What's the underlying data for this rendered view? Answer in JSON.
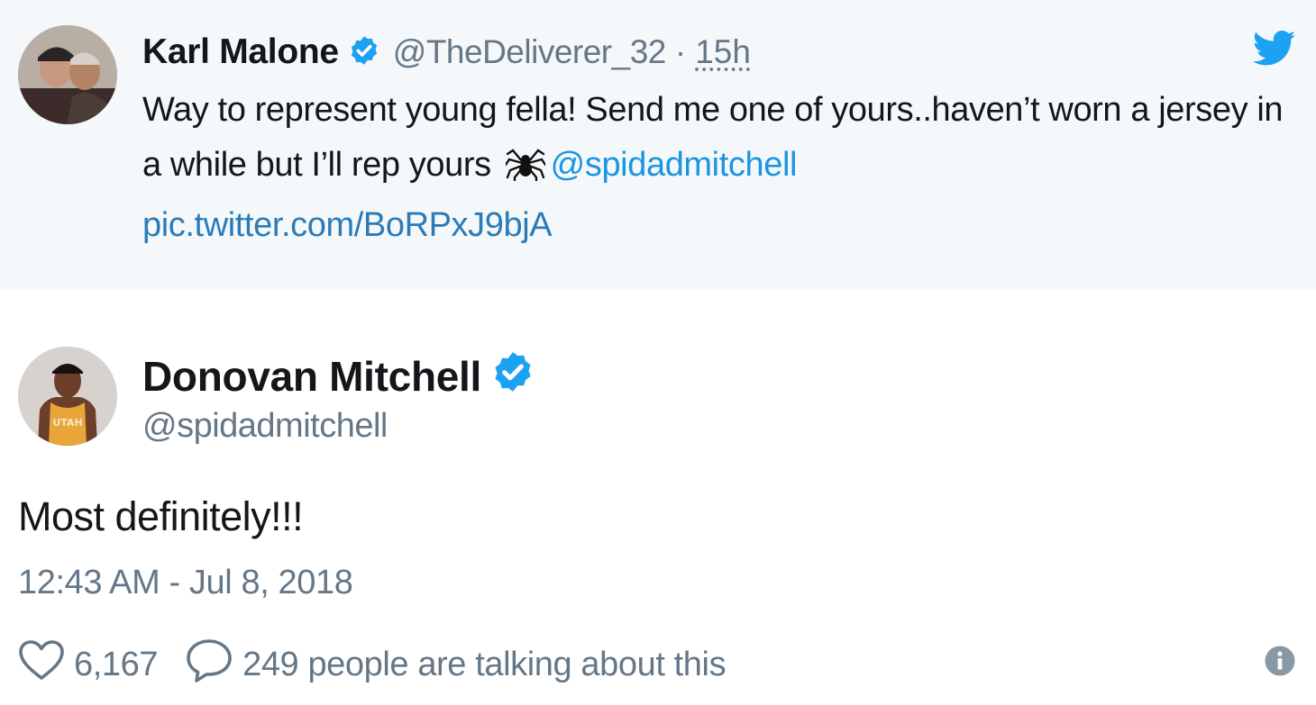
{
  "quoted_tweet": {
    "author_name": "Karl Malone",
    "handle": "@TheDeliverer_32",
    "separator": "·",
    "time": "15h",
    "text_part1": "Way to represent young fella! Send me one of yours..haven’t worn a jersey in a while but I’ll rep yours",
    "mention": "@spidadmitchell",
    "pic_link": "pic.twitter.com/BoRPxJ9bjA",
    "icons": {
      "verified": "verified-badge-icon",
      "bird": "twitter-bird-icon",
      "emoji": "spider-icon"
    }
  },
  "main_tweet": {
    "author_name": "Donovan Mitchell",
    "handle": "@spidadmitchell",
    "text": "Most definitely!!!",
    "datetime": "12:43 AM - Jul 8, 2018",
    "likes": "6,167",
    "talking": "249 people are talking about this",
    "icons": {
      "like": "heart-icon",
      "reply": "speech-bubble-icon",
      "info": "info-icon"
    }
  },
  "colors": {
    "accent": "#1da1f2",
    "link": "#1b95e0",
    "muted": "#657786",
    "quoted_bg": "#f5f8fa"
  }
}
